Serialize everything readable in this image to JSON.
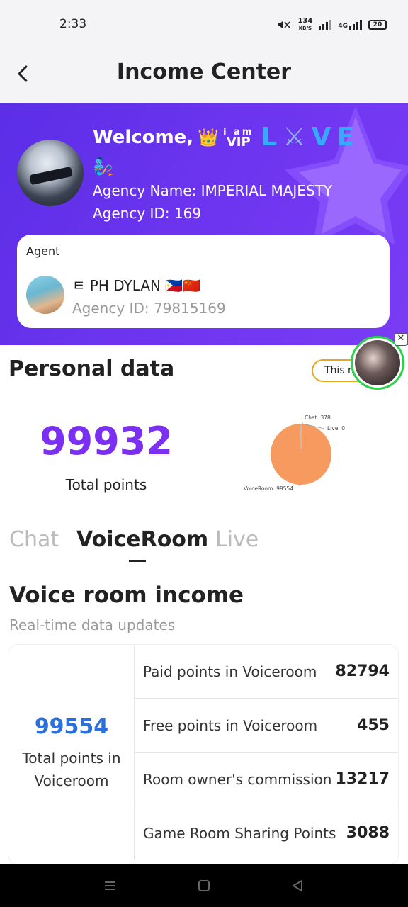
{
  "status_bar": {
    "time": "2:33",
    "speed_value": "134",
    "speed_unit": "KB/S",
    "network": "4G",
    "battery": "20"
  },
  "header": {
    "title": "Income Center"
  },
  "banner": {
    "welcome": "Welcome,",
    "vip_line1": "i am",
    "vip_line2": "VIP",
    "love": [
      "L",
      "⚔",
      "V",
      "E"
    ],
    "emoji_line": "🧞",
    "agency_name": "Agency Name: IMPERIAL MAJESTY",
    "agency_id": "Agency ID: 169",
    "agent": {
      "label": "Agent",
      "name": "ㅌ PH DYLAN 🇵🇭🇨🇳",
      "agency_id": "Agency ID: 79815169"
    }
  },
  "personal": {
    "title": "Personal data",
    "period_button": "This m",
    "total_points": "99932",
    "total_label": "Total points"
  },
  "chart_data": {
    "type": "pie",
    "slices": [
      {
        "name": "VoiceRoom",
        "value": 99554,
        "label": "VoiceRoom: 99554"
      },
      {
        "name": "Chat",
        "value": 378,
        "label": "Chat: 378"
      },
      {
        "name": "Live",
        "value": 0,
        "label": "Live: 0"
      }
    ],
    "colors": [
      "#f79a5f",
      "#9e9e9e",
      "#9e9e9e"
    ]
  },
  "tabs": [
    "Chat",
    "VoiceRoom",
    "Live"
  ],
  "active_tab": "VoiceRoom",
  "voice": {
    "title": "Voice room income",
    "subtitle": "Real-time data updates",
    "total_value": "99554",
    "total_label": "Total points in Voiceroom",
    "rows": [
      {
        "label": "Paid points in Voiceroom",
        "value": "82794"
      },
      {
        "label": "Free points in Voiceroom",
        "value": "455"
      },
      {
        "label": "Room owner's commission",
        "value": "13217"
      },
      {
        "label": "Game Room Sharing Points",
        "value": "3088"
      }
    ]
  },
  "colors": {
    "banner": "#6c34ef",
    "total_points": "#7b2ff2",
    "voice_total": "#2a6fdb",
    "period_border": "#e6a821",
    "float_border": "#2bd34b"
  }
}
